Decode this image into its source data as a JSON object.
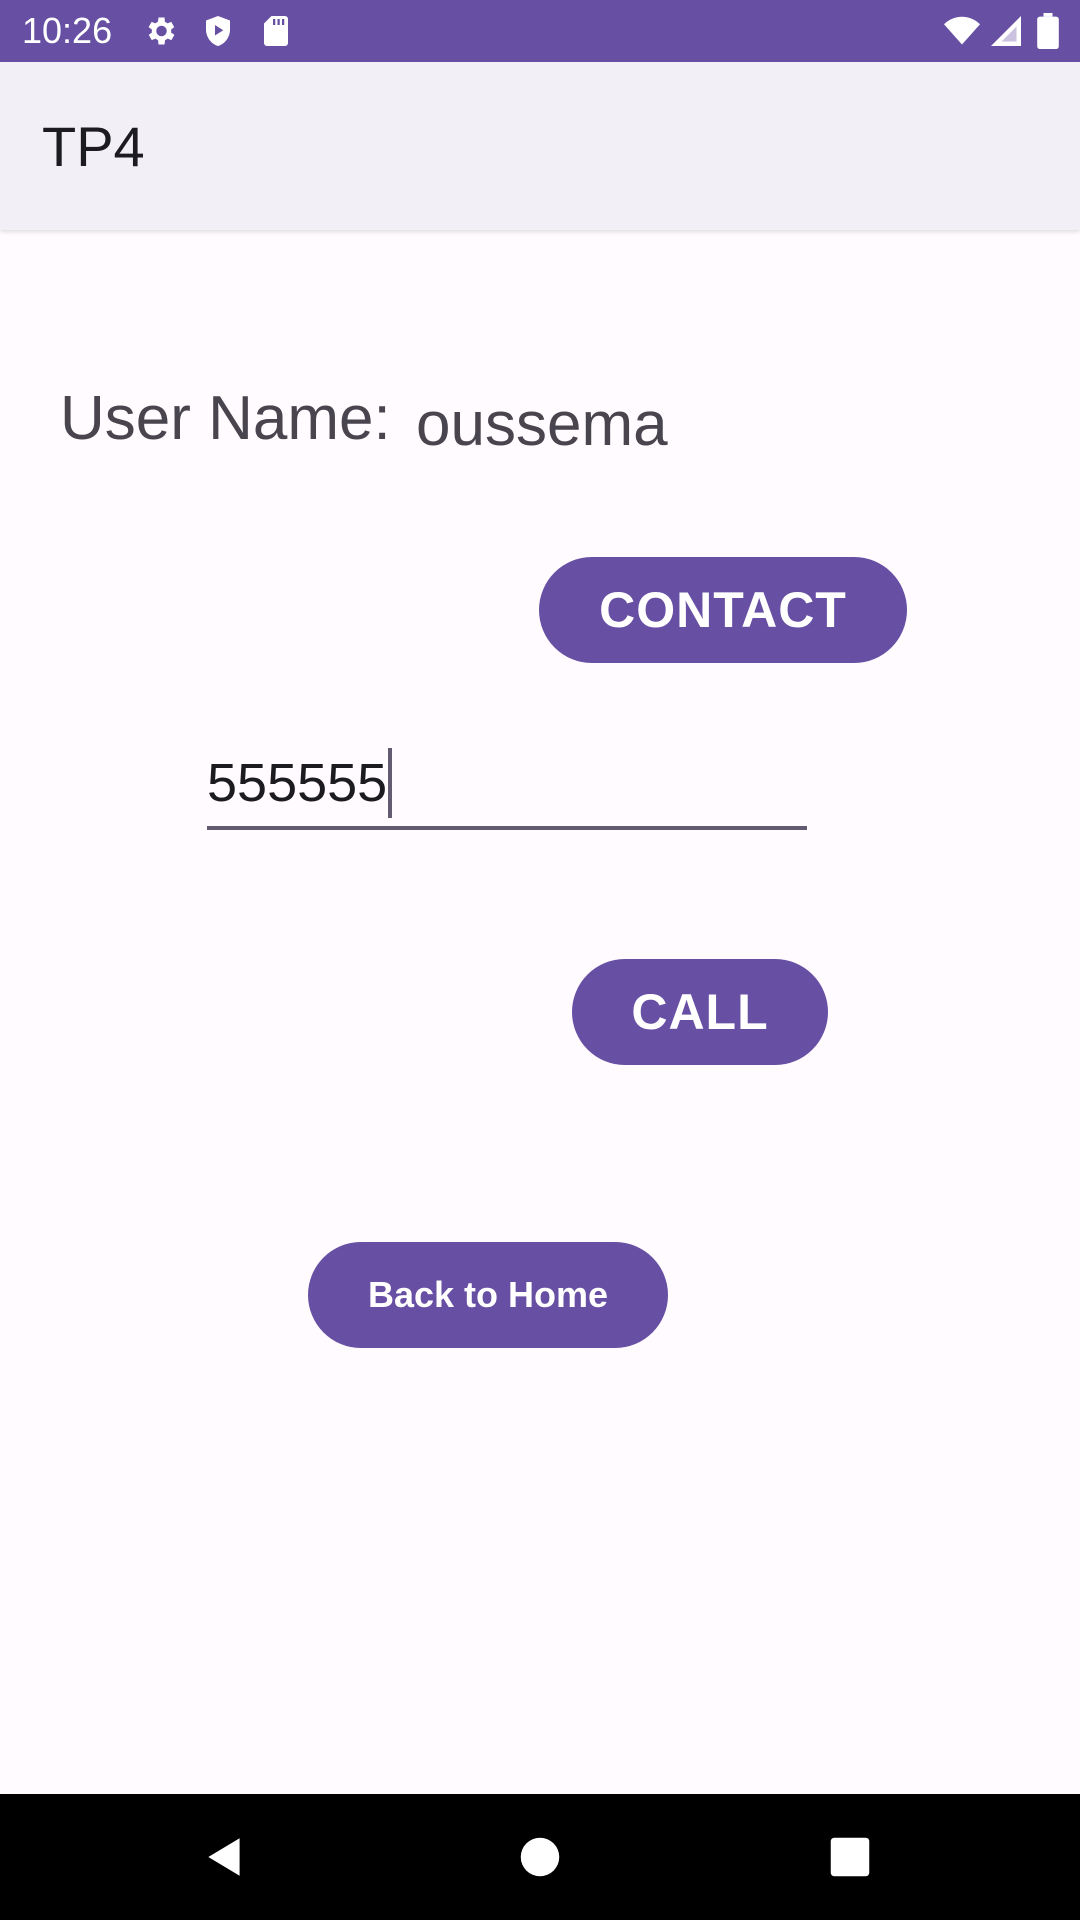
{
  "status_bar": {
    "time": "10:26",
    "icons": [
      "gear-icon",
      "shield-play-icon",
      "sd-card-icon",
      "wifi-icon",
      "signal-icon",
      "battery-icon"
    ]
  },
  "app_bar": {
    "title": "TP4"
  },
  "content": {
    "username_label": "User Name:",
    "username_value": "oussema",
    "contact_button": "CONTACT",
    "phone_value": "555555",
    "call_button": "CALL",
    "home_button": "Back to Home"
  },
  "nav_bar": {
    "icons": [
      "back-icon",
      "home-icon",
      "recents-icon"
    ]
  },
  "colors": {
    "primary": "#6750a4",
    "surface": "#fffbfe",
    "app_bar": "#f3eff6",
    "text": "#49454f"
  }
}
